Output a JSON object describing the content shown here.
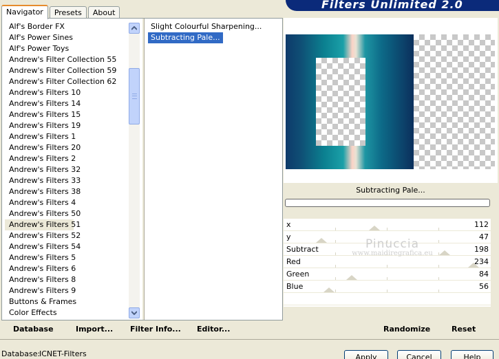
{
  "tabs": [
    {
      "label": "Navigator",
      "active": true
    },
    {
      "label": "Presets",
      "active": false
    },
    {
      "label": "About",
      "active": false
    }
  ],
  "banner": {
    "title": "Filters Unlimited 2.0"
  },
  "categories": [
    "Alf's Border FX",
    "Alf's Power Sines",
    "Alf's Power Toys",
    "Andrew's Filter Collection 55",
    "Andrew's Filter Collection 59",
    "Andrew's Filter Collection 62",
    "Andrew's Filters 10",
    "Andrew's Filters 14",
    "Andrew's Filters 15",
    "Andrew's Filters 19",
    "Andrew's Filters 1",
    "Andrew's Filters 20",
    "Andrew's Filters 2",
    "Andrew's Filters 32",
    "Andrew's Filters 33",
    "Andrew's Filters 38",
    "Andrew's Filters 4",
    "Andrew's Filters 50",
    "Andrew's Filters 51",
    "Andrew's Filters 52",
    "Andrew's Filters 54",
    "Andrew's Filters 5",
    "Andrew's Filters 6",
    "Andrew's Filters 8",
    "Andrew's Filters 9",
    "Buttons & Frames",
    "Color Effects"
  ],
  "selected_category_index": 18,
  "filters": [
    "Slight Colourful Sharpening...",
    "Subtracting Pale..."
  ],
  "selected_filter_index": 1,
  "preview": {
    "filter_name": "Subtracting Pale..."
  },
  "sliders": [
    {
      "label": "x",
      "value": "112",
      "level": 112
    },
    {
      "label": "y",
      "value": "47",
      "level": 47
    },
    {
      "label": "Subtract",
      "value": "198",
      "level": 198
    },
    {
      "label": "Red",
      "value": "234",
      "level": 234
    },
    {
      "label": "Green",
      "value": "84",
      "level": 84
    },
    {
      "label": "Blue",
      "value": "56",
      "level": 56
    }
  ],
  "watermark": {
    "line1": "Pinuccia",
    "line2": "www.maidiregrafica.eu"
  },
  "toolbar": {
    "database": "Database",
    "import": "Import...",
    "filter_info": "Filter Info...",
    "editor": "Editor...",
    "randomize": "Randomize",
    "reset": "Reset"
  },
  "status": {
    "label": "Database:",
    "value": "ICNET-Filters"
  },
  "buttons": {
    "apply": "Apply",
    "cancel": "Cancel",
    "help": "Help"
  }
}
